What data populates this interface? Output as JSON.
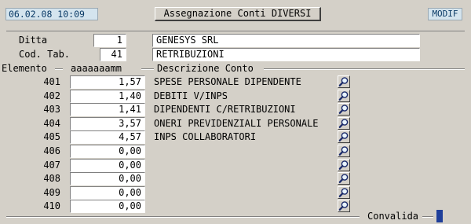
{
  "header": {
    "datetime": "06.02.08 10:09",
    "title": "Assegnazione Conti DIVERSI",
    "mode": "MODIF"
  },
  "form": {
    "ditta_label": "Ditta",
    "ditta_code": "1",
    "ditta_name": "GENESYS SRL",
    "codtab_label": "Cod. Tab.",
    "codtab_code": "41",
    "codtab_name": "RETRIBUZIONI"
  },
  "grid": {
    "col_elemento": "Elemento",
    "col_value": "aaaaaaamm",
    "col_desc": "Descrizione Conto",
    "rows": [
      {
        "num": "401",
        "value": "1,57",
        "desc": "SPESE PERSONALE DIPENDENTE"
      },
      {
        "num": "402",
        "value": "1,40",
        "desc": "DEBITI V/INPS"
      },
      {
        "num": "403",
        "value": "1,41",
        "desc": "DIPENDENTI C/RETRIBUZIONI"
      },
      {
        "num": "404",
        "value": "3,57",
        "desc": "ONERI PREVIDENZIALI PERSONALE"
      },
      {
        "num": "405",
        "value": "4,57",
        "desc": "INPS COLLABORATORI"
      },
      {
        "num": "406",
        "value": "0,00",
        "desc": ""
      },
      {
        "num": "407",
        "value": "0,00",
        "desc": ""
      },
      {
        "num": "408",
        "value": "0,00",
        "desc": ""
      },
      {
        "num": "409",
        "value": "0,00",
        "desc": ""
      },
      {
        "num": "410",
        "value": "0,00",
        "desc": ""
      }
    ],
    "lookup_icon": "magnifier-icon"
  },
  "footer": {
    "convalida_label": "Convalida"
  },
  "colors": {
    "background": "#d4d0c8",
    "stamp_bg": "#d4e4ee",
    "stamp_text": "#0a3a66",
    "indicator": "#1f3f9a"
  }
}
